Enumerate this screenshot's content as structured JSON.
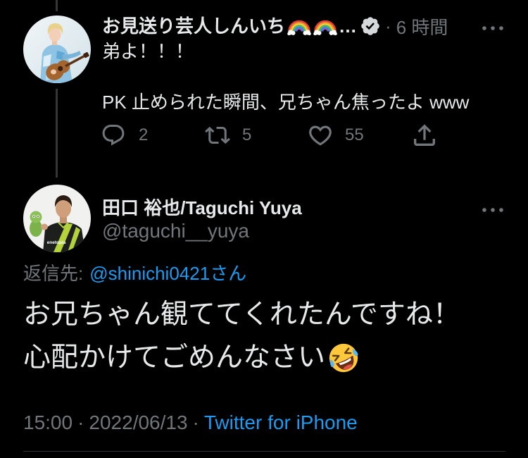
{
  "colors": {
    "background": "#000000",
    "primary_text": "#e7e9ea",
    "secondary_text": "#71767b",
    "link": "#1d9bf0",
    "verified_badge": "#d6d9db",
    "divider": "#2f3336",
    "thread_line": "#333639"
  },
  "parent_tweet": {
    "author": {
      "display_name": "お見送り芸人しんいち",
      "name_emoji_icons": [
        "rainbow-emoji-icon",
        "rainbow-emoji-icon"
      ],
      "truncation": "…",
      "badge_icon": "verified-badge-icon"
    },
    "separator": "·",
    "relative_time": "6 時間",
    "more_icon": "more-horizontal-icon",
    "text_lines": [
      "弟よ！！！",
      "PK 止められた瞬間、兄ちゃん焦ったよ www"
    ],
    "actions": {
      "reply": {
        "icon": "reply-icon",
        "count": "2"
      },
      "retweet": {
        "icon": "retweet-icon",
        "count": "5"
      },
      "like": {
        "icon": "heart-icon",
        "count": "55"
      },
      "share": {
        "icon": "share-icon"
      }
    }
  },
  "main_tweet": {
    "author": {
      "display_name": "田口 裕也/Taguchi Yuya",
      "handle": "@taguchi__yuya",
      "avatar_jersey_logo": "enetopia"
    },
    "more_icon": "more-horizontal-icon",
    "replying_to": {
      "label": "返信先:",
      "mention": "@shinichi0421",
      "suffix": "さん"
    },
    "text_lines": [
      "お兄ちゃん観ててくれたんですね！",
      "心配かけてごめんなさい"
    ],
    "text_emoji_icon": "rolling-on-the-floor-laughing-emoji-icon",
    "meta": {
      "time": "15:00",
      "separator": "·",
      "date": "2022/06/13",
      "source": "Twitter for iPhone"
    }
  }
}
